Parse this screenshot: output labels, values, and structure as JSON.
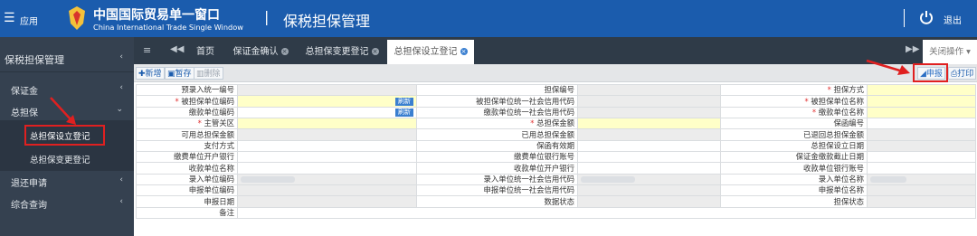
{
  "header": {
    "app_label": "应用",
    "logo_cn": "中国国际贸易单一窗口",
    "logo_en": "China International Trade Single Window",
    "divider": "|",
    "system_title": "保税担保管理",
    "logout_label": "退出",
    "colors": {
      "bar": "#1b5cad",
      "sidebar": "#354150"
    }
  },
  "sidebar": {
    "title": "保税担保管理",
    "items": [
      {
        "label": "保证金"
      },
      {
        "label": "总担保"
      },
      {
        "label": "总担保设立登记"
      },
      {
        "label": "总担保变更登记"
      },
      {
        "label": "退还申请"
      },
      {
        "label": "综合查询"
      }
    ]
  },
  "tabs": {
    "items": [
      {
        "label": "首页"
      },
      {
        "label": "保证金确认"
      },
      {
        "label": "总担保变更登记"
      },
      {
        "label": "总担保设立登记"
      }
    ],
    "close_ops": "关闭操作"
  },
  "toolbar": {
    "add": "新增",
    "save": "暂存",
    "delete": "删除",
    "declare": "申报",
    "print": "打印"
  },
  "form": {
    "refresh": "刷新",
    "rows": [
      [
        "预录入统一编号",
        "担保编号",
        "担保方式"
      ],
      [
        "被担保单位编码",
        "被担保单位统一社会信用代码",
        "被担保单位名称"
      ],
      [
        "缴款单位编码",
        "缴款单位统一社会信用代码",
        "缴款单位名称"
      ],
      [
        "主管关区",
        "总担保金额",
        "保函编号"
      ],
      [
        "可用总担保金额",
        "已用总担保金额",
        "已退回总担保金额"
      ],
      [
        "支付方式",
        "保函有效期",
        "总担保设立日期"
      ],
      [
        "缴费单位开户银行",
        "缴费单位银行账号",
        "保证金缴款截止日期"
      ],
      [
        "收款单位名称",
        "收款单位开户银行",
        "收款单位银行账号"
      ],
      [
        "录入单位编码",
        "录入单位统一社会信用代码",
        "录入单位名称"
      ],
      [
        "申报单位编码",
        "申报单位统一社会信用代码",
        "申报单位名称"
      ],
      [
        "申报日期",
        "数据状态",
        "担保状态"
      ],
      [
        "备注"
      ]
    ]
  }
}
